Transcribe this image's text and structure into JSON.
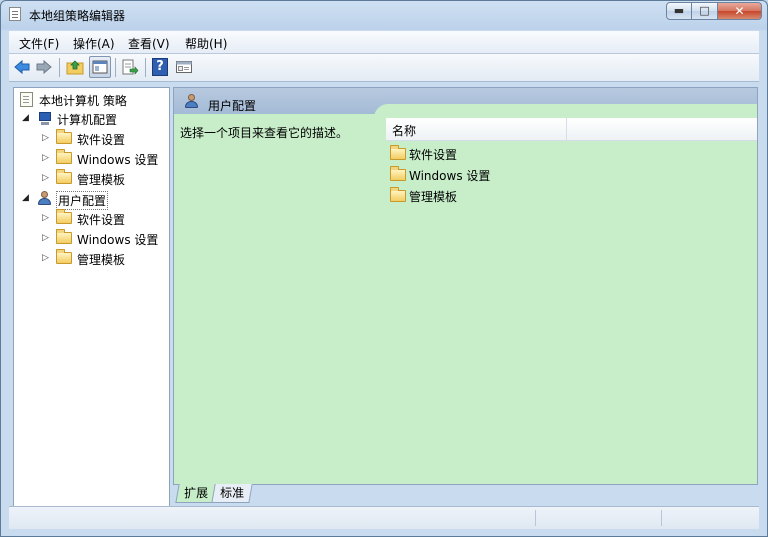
{
  "window": {
    "title": "本地组策略编辑器"
  },
  "window_controls": {
    "minimize": "▬",
    "maximize": "□",
    "close": "✕"
  },
  "menu": [
    {
      "label": "文件(F)"
    },
    {
      "label": "操作(A)"
    },
    {
      "label": "查看(V)"
    },
    {
      "label": "帮助(H)"
    }
  ],
  "toolbar": {
    "back_icon": "back-arrow-icon",
    "forward_icon": "forward-arrow-icon",
    "up_icon": "up-folder-icon",
    "show_hide_tree_icon": "console-tree-icon",
    "export_icon": "export-list-icon",
    "help_icon": "help-icon",
    "properties_icon": "properties-icon",
    "help_glyph": "?"
  },
  "tree": {
    "root": "本地计算机 策略",
    "computer_config": {
      "label": "计算机配置",
      "children": [
        "软件设置",
        "Windows 设置",
        "管理模板"
      ]
    },
    "user_config": {
      "label": "用户配置",
      "children": [
        "软件设置",
        "Windows 设置",
        "管理模板"
      ]
    }
  },
  "details": {
    "header": "用户配置",
    "description": "选择一个项目来查看它的描述。",
    "column_name": "名称",
    "items": [
      "软件设置",
      "Windows 设置",
      "管理模板"
    ]
  },
  "tabs": [
    "扩展",
    "标准"
  ],
  "colors": {
    "pane_green": "#c7edc9",
    "header_blue": "#a4bbd6",
    "window_frame": "#bcd2ea"
  }
}
